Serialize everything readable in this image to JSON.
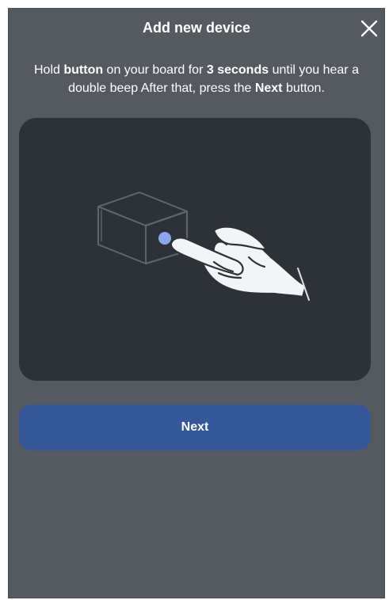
{
  "dialog": {
    "title": "Add new device",
    "close_icon": "close-icon"
  },
  "instruction": {
    "part1": "Hold ",
    "button_word": "button",
    "part2": " on your board for ",
    "duration": "3 seconds",
    "part3": " until you hear a double beep After that, press the ",
    "next_word": "Next",
    "part4": " button."
  },
  "illustration": {
    "icon": "hand-pressing-device-button-illustration",
    "button_color": "#8aa9ec"
  },
  "actions": {
    "next_label": "Next"
  },
  "colors": {
    "dialog_background": "#555a60",
    "panel_background": "#2d3238",
    "primary_button": "#34589a",
    "text": "#ffffff"
  }
}
